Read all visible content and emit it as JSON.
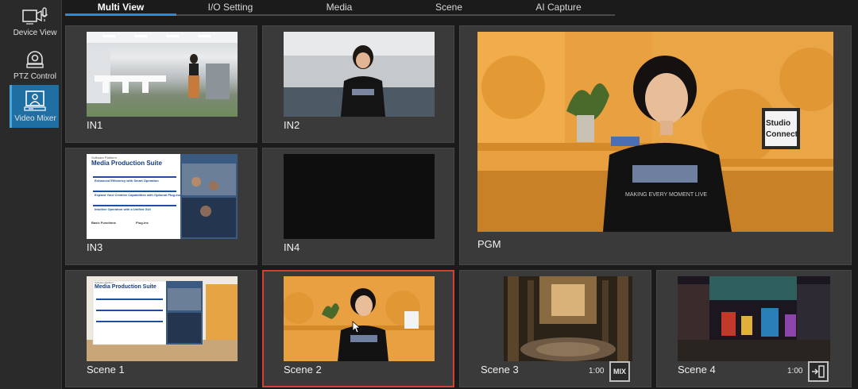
{
  "sidebar": {
    "items": [
      {
        "label": "Device View",
        "icon": "camera-mic-icon",
        "active": false
      },
      {
        "label": "PTZ Control",
        "icon": "ptz-camera-icon",
        "active": false
      },
      {
        "label": "Video Mixer",
        "icon": "video-mixer-icon",
        "active": true
      }
    ]
  },
  "tabs": [
    {
      "label": "Multi View",
      "active": true
    },
    {
      "label": "I/O Setting",
      "active": false
    },
    {
      "label": "Media",
      "active": false
    },
    {
      "label": "Scene",
      "active": false
    },
    {
      "label": "AI Capture",
      "active": false
    }
  ],
  "inputs": {
    "in1": "IN1",
    "in2": "IN2",
    "in3": "IN3",
    "in4": "IN4"
  },
  "program": {
    "label": "PGM"
  },
  "scenes": {
    "scene1": {
      "label": "Scene 1"
    },
    "scene2": {
      "label": "Scene 2",
      "selected": true
    },
    "scene3": {
      "label": "Scene 3",
      "duration": "1:00",
      "transition": "MIX"
    },
    "scene4": {
      "label": "Scene 4",
      "duration": "1:00",
      "transition_icon": "cut-transition-icon"
    }
  },
  "slide": {
    "title": "Media Production Suite",
    "subtitle": "Software Platform",
    "line1": "Enhanced Efficiency with Smart Operation",
    "line2": "Expand Your Creative Capabilities with Optional Plug-ins",
    "line3": "Intuitive Operation with a Unified GUI",
    "basic": "Basic Functions",
    "plugin": "Plug-ins"
  },
  "studio_sign": "Studio Connect",
  "colors": {
    "accent": "#2d8ad6",
    "selected_border": "#d5412f",
    "arrow": "#f08a1c",
    "sidebar_active": "#1f6fa3"
  }
}
